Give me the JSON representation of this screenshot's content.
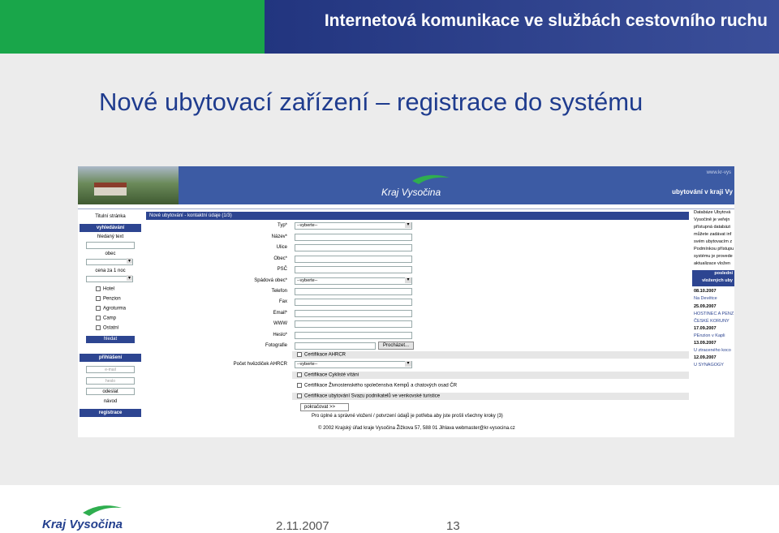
{
  "slide": {
    "header_title": "Internetová komunikace ve službách cestovního ruchu",
    "title": "Nové ubytovací zařízení – registrace do systému",
    "footer_date": "2.11.2007",
    "footer_page": "13",
    "footer_logo_text": "Kraj Vysočina",
    "colors": {
      "header_green": "#19a64a",
      "header_blue": "#22357f",
      "title_blue": "#1f3c8e",
      "nav_blue": "#2d4591"
    }
  },
  "site": {
    "url": "www.kr-vys",
    "header_title": "ubytování v kraji Vy",
    "logo_text": "Kraj Vysočina",
    "left_nav": {
      "home": "Titulní stránka",
      "search_header": "vyhledávání",
      "search_text": "hledaný text",
      "city": "obec",
      "price": "cena za 1 noc",
      "types": [
        "Hotel",
        "Penzion",
        "Agroturma",
        "Camp",
        "Ostatní"
      ],
      "search_button": "hledat",
      "login_header": "přihlášení",
      "email_placeholder": "e-mail",
      "password_placeholder": "heslo",
      "send_button": "odeslat",
      "help": "návod",
      "register": "registrace"
    },
    "form": {
      "heading": "Nové ubytování - kontaktní údaje (1/3)",
      "fields": [
        {
          "label": "Typ*",
          "value": "--vyberte--",
          "type": "select"
        },
        {
          "label": "Název*",
          "value": "",
          "type": "text"
        },
        {
          "label": "Ulice",
          "value": "",
          "type": "text"
        },
        {
          "label": "Obec*",
          "value": "",
          "type": "text"
        },
        {
          "label": "PSČ",
          "value": "",
          "type": "text"
        },
        {
          "label": "Spádová obec*",
          "value": "--vyberte--",
          "type": "select"
        },
        {
          "label": "Telefon",
          "value": "",
          "type": "text"
        },
        {
          "label": "Fax",
          "value": "",
          "type": "text"
        },
        {
          "label": "Email*",
          "value": "",
          "type": "text"
        },
        {
          "label": "WWW",
          "value": "",
          "type": "text"
        },
        {
          "label": "Heslo*",
          "value": "",
          "type": "text"
        }
      ],
      "photo_label": "Fotografie",
      "browse_button": "Procházet...",
      "certificate_ahrcr": "Certifikace AHRCR",
      "stars_label": "Počet hvězdiček AHRCR",
      "stars_value": "--vyberte--",
      "certificates": [
        "Certifikace Cyklisté vítáni",
        "Certifikace Živnostenského společenstva Kempů a chatových osad ČR",
        "Certifikace ubytování Svazu podnikatelů ve venkovské turistice"
      ],
      "continue_button": "pokračovat >>",
      "note": "Pro úplné a správné vložení / potvrzení údajů je potřeba aby jste prošli všechny kroky (3)",
      "copyright": "© 2002 Krajský úřad kraje Vysočina    Žižkova 57, 588 01 Jihlava    webmaster@kr-vysocina.cz"
    },
    "right_nav": {
      "info_lines": [
        "Databáze Ubytová",
        "Vysočině je veřejn",
        "přístupná databázi",
        "můžete zadávat inf",
        "svém ubytovacím z",
        "Podmínkou přístupu",
        "systému je provede",
        "aktualizace vložen"
      ],
      "latest_header_1": "poslední",
      "latest_header_2": "vložených uby",
      "entries": [
        {
          "date": "08.10.2007",
          "name": "Na Devětce"
        },
        {
          "date": "25.09.2007",
          "name": "HOSTINEC A PENZ ČESKÉ KORUNY"
        },
        {
          "date": "17.09.2007",
          "name": "PEnzion v Kapli"
        },
        {
          "date": "13.09.2007",
          "name": "U ztraceného koco"
        },
        {
          "date": "12.09.2007",
          "name": "U SYNAGOGY"
        }
      ]
    }
  }
}
